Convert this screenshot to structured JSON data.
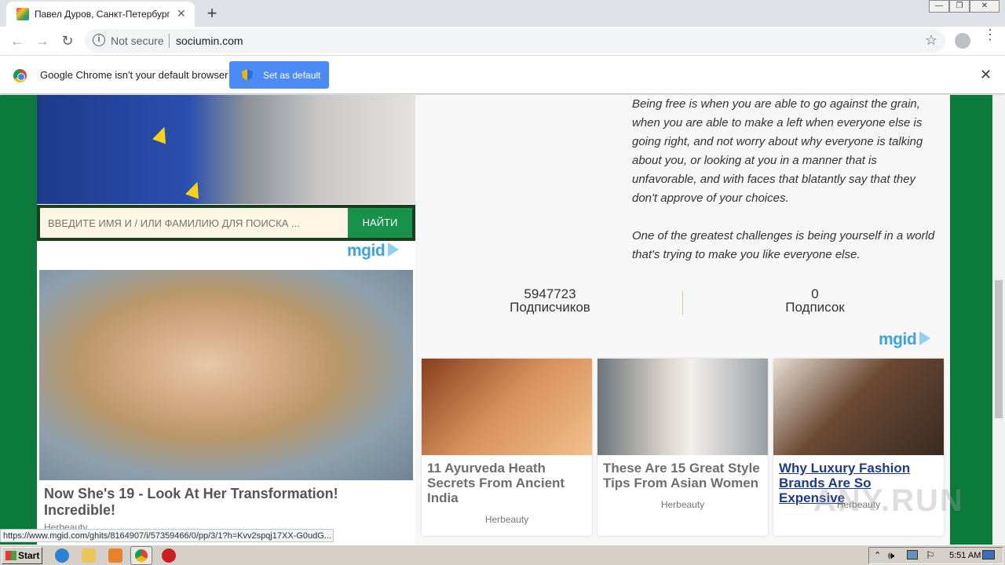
{
  "browser": {
    "tab_title": "Павел Дуров, Санкт-Петербург | Соцiумин",
    "tab_close": "✕",
    "new_tab": "+",
    "back": "←",
    "forward": "→",
    "reload": "↻",
    "security_label": "Not secure",
    "url": "sociumin.com",
    "star": "☆",
    "menu": "⋮"
  },
  "window_controls": {
    "minimize": "—",
    "restore": "❐",
    "close": "✕"
  },
  "infobar": {
    "message": "Google Chrome isn't your default browser",
    "button_label": "Set as default",
    "close": "✕"
  },
  "search": {
    "placeholder": "ВВЕДИТЕ ИМЯ И / ИЛИ ФАМИЛИЮ ДЛЯ ПОИСКА ...",
    "button_label": "НАЙТИ"
  },
  "ad_brand": "mgid",
  "ad_main": {
    "title": "Now She's 19 - Look At Her Transformation! Incredible!",
    "source": "Herbeauty"
  },
  "quote": {
    "paragraph_1": "Being free is when you are able to go against the grain, when you are able to make a left when everyone else is going right, and not worry about why everyone is talking about you, or looking at you in a manner that is unfavorable, and with faces that blatantly say that they don't approve of your choices.",
    "paragraph_2": "One of the greatest challenges is being yourself in a world that's trying to make you like everyone else."
  },
  "stats": {
    "subscribers_count": "5947723",
    "subscribers_label": "Подписчиков",
    "subscriptions_count": "0",
    "subscriptions_label": "Подписок"
  },
  "cards": [
    {
      "title": "11 Ayurveda Heath Secrets From Ancient India",
      "source": "Herbeauty",
      "color": "#c8774a"
    },
    {
      "title": "These Are 15 Great Style Tips From Asian Women",
      "source": "Herbeauty",
      "color": "#d9d4cf"
    },
    {
      "title": "Why Luxury Fashion Brands Are So Expensive",
      "source": "Herbeauty",
      "color": "#6b4a35"
    }
  ],
  "watermark": "ANY.RUN",
  "status_url": "https://www.mgid.com/ghits/8164907/i/57359466/0/pp/3/1?h=Kvv2spqj17XX-G0udG...",
  "taskbar": {
    "start_label": "Start",
    "clock": "5:51 AM"
  }
}
